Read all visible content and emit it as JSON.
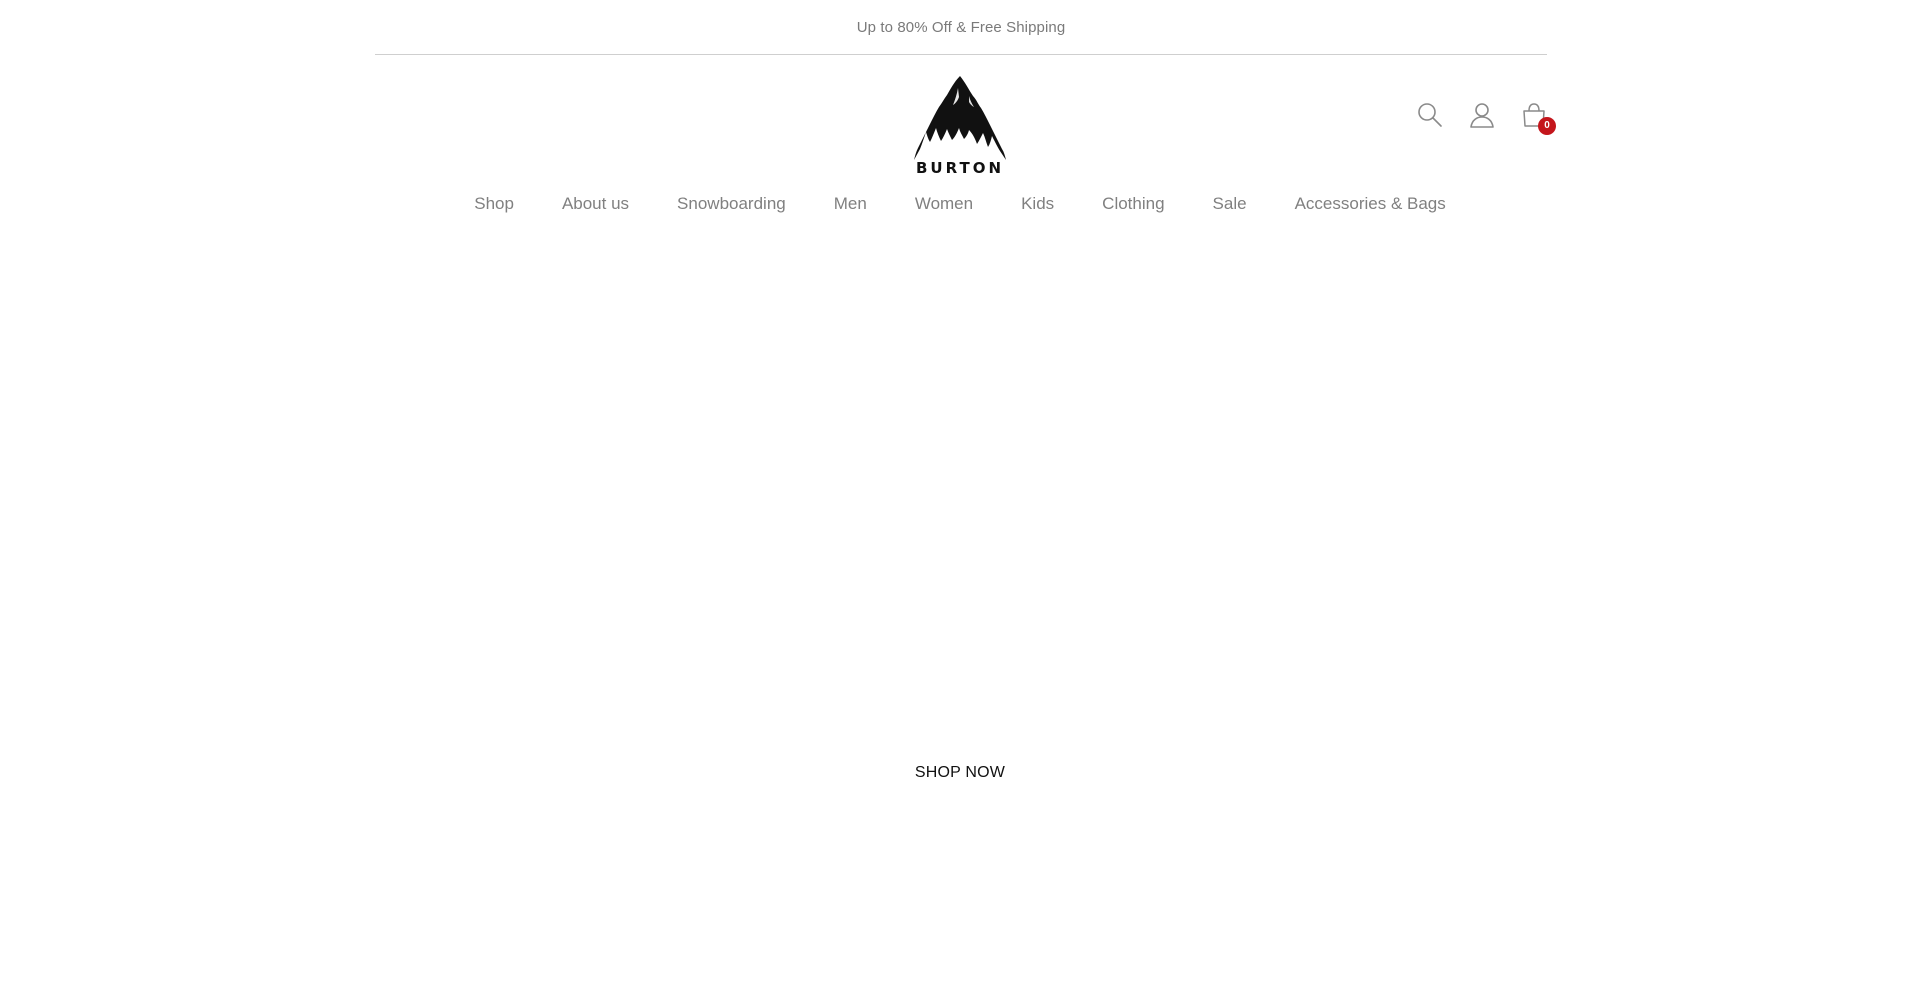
{
  "announcement": {
    "text": "Up to 80% Off & Free Shipping"
  },
  "brand": {
    "logo_text": "BURTON",
    "logo_icon": "mountain-logo-icon"
  },
  "header_icons": {
    "search_icon": "search-icon",
    "account_icon": "user-icon",
    "cart_icon": "shopping-bag-icon",
    "cart_count": "0",
    "cart_badge_color": "#c4161c"
  },
  "nav": {
    "items": [
      {
        "label": "Shop"
      },
      {
        "label": "About us"
      },
      {
        "label": "Snowboarding"
      },
      {
        "label": "Men"
      },
      {
        "label": "Women"
      },
      {
        "label": "Kids"
      },
      {
        "label": "Clothing"
      },
      {
        "label": "Sale"
      },
      {
        "label": "Accessories & Bags"
      }
    ]
  },
  "hero": {
    "cta_label": "SHOP NOW"
  },
  "colors": {
    "text_muted": "#808080",
    "accent": "#c4161c",
    "logo": "#111111"
  }
}
